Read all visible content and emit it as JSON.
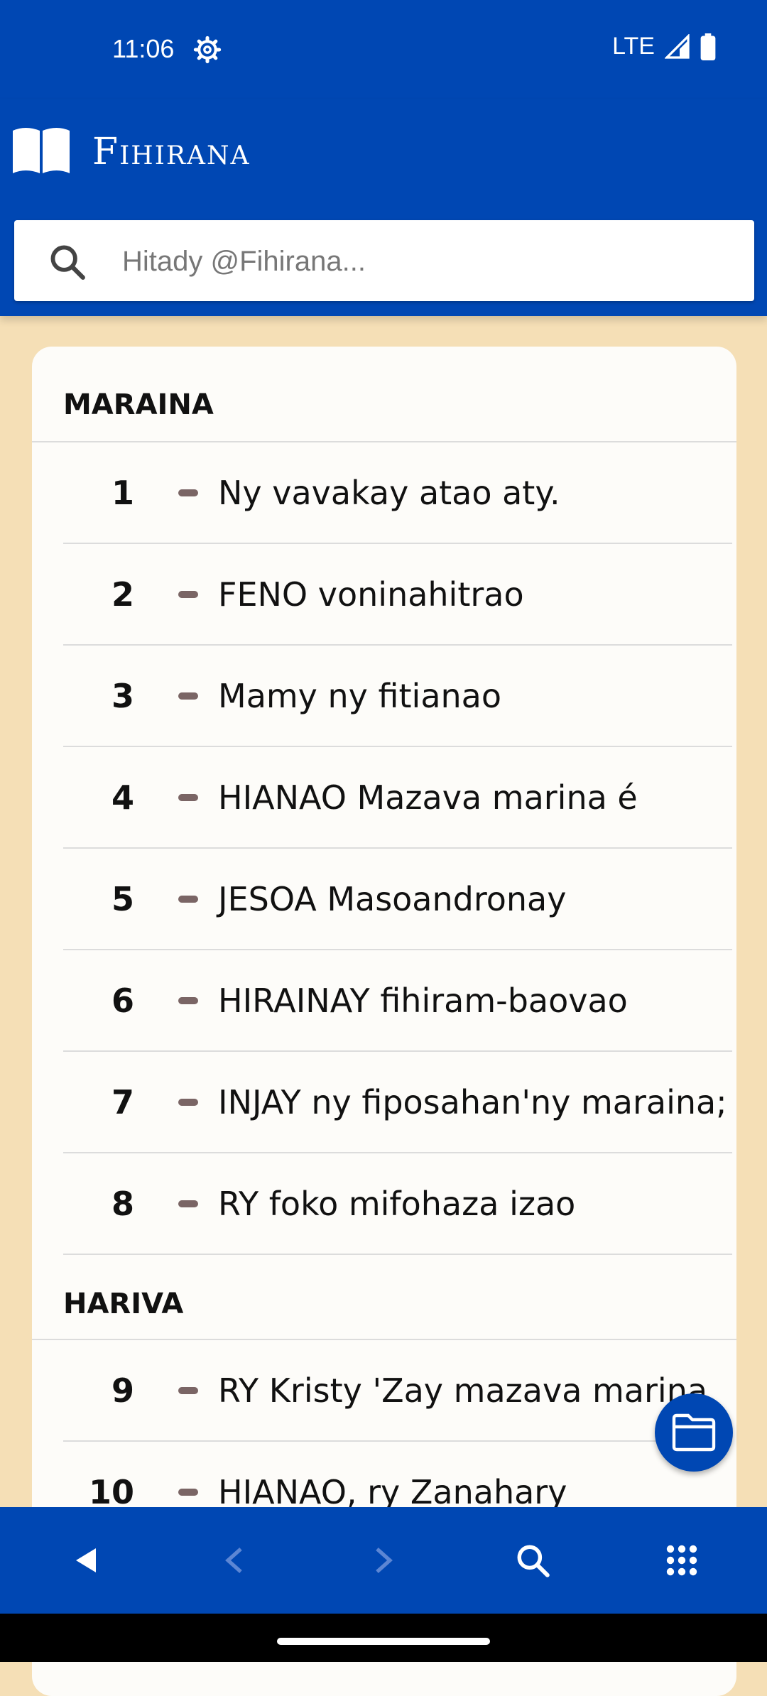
{
  "status": {
    "time": "11:06",
    "network": "LTE"
  },
  "header": {
    "title": "Fihirana"
  },
  "search": {
    "placeholder": "Hitady @Fihirana..."
  },
  "sections": [
    {
      "title": "MARAINA",
      "songs": [
        {
          "num": "1",
          "title": "Ny vavakay atao aty."
        },
        {
          "num": "2",
          "title": "FENO voninahitrao"
        },
        {
          "num": "3",
          "title": "Mamy ny fitianao"
        },
        {
          "num": "4",
          "title": "HIANAO Mazava marina é"
        },
        {
          "num": "5",
          "title": "JESOA Masoandronay"
        },
        {
          "num": "6",
          "title": "HIRAINAY fihiram-baovao"
        },
        {
          "num": "7",
          "title": "INJAY ny fiposahan'ny maraina;"
        },
        {
          "num": "8",
          "title": "RY foko mifohaza izao"
        }
      ]
    },
    {
      "title": "HARIVA",
      "songs": [
        {
          "num": "9",
          "title": "RY Kristy 'Zay mazava marina"
        },
        {
          "num": "10",
          "title": "HIANAO, ry Zanahary"
        }
      ]
    }
  ],
  "icons": {
    "logo": "open-book-icon",
    "search": "search-icon",
    "fab": "folder-icon",
    "nav": [
      "back-triangle-icon",
      "chevron-left-icon",
      "chevron-right-icon",
      "search-icon",
      "grid-icon"
    ]
  },
  "colors": {
    "primary": "#0047b3",
    "background": "#f5dfb6",
    "card": "#fdfcf9"
  }
}
